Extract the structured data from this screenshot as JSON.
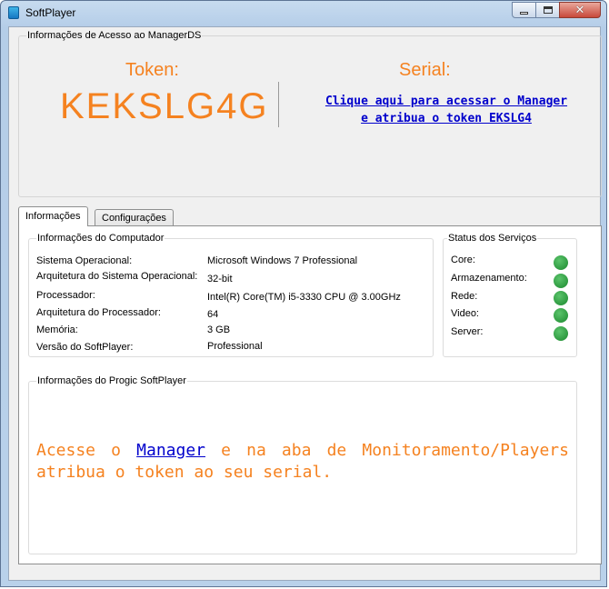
{
  "window": {
    "title": "SoftPlayer"
  },
  "access": {
    "legend": "Informações de Acesso ao ManagerDS",
    "token_label": "Token:",
    "token_value": "KEKSLG4G",
    "serial_label": "Serial:",
    "serial_link_line1": "Clique aqui para acessar o Manager",
    "serial_link_line2": "e atribua o token EKSLG4"
  },
  "tabs": [
    {
      "label": "Informações",
      "active": true
    },
    {
      "label": "Configurações",
      "active": false
    }
  ],
  "computer": {
    "legend": "Informações do Computador",
    "rows": [
      {
        "label": "Sistema Operacional:",
        "value": "Microsoft Windows 7 Professional"
      },
      {
        "label": "Arquitetura do Sistema Operacional:",
        "value": "32-bit"
      },
      {
        "label": "Processador:",
        "value": "Intel(R) Core(TM) i5-3330 CPU @ 3.00GHz"
      },
      {
        "label": "Arquitetura do Processador:",
        "value": "64"
      },
      {
        "label": "Memória:",
        "value": "3 GB"
      },
      {
        "label": "Versão do SoftPlayer:",
        "value": "Professional"
      }
    ]
  },
  "status": {
    "legend": "Status dos Serviços",
    "services": [
      {
        "label": "Core:",
        "state": "ok"
      },
      {
        "label": "Armazenamento:",
        "state": "ok"
      },
      {
        "label": "Rede:",
        "state": "ok"
      },
      {
        "label": "Video:",
        "state": "ok"
      },
      {
        "label": "Server:",
        "state": "ok"
      }
    ]
  },
  "progic": {
    "legend": "Informações do Progic SoftPlayer",
    "message_before": "Acesse o ",
    "message_link": "Manager",
    "message_after": " e na aba de Monitoramento/Players atribua o token ao seu serial."
  },
  "colors": {
    "accent_orange": "#f58220",
    "link_blue": "#0000cc",
    "status_ok": "#2e9a40"
  }
}
